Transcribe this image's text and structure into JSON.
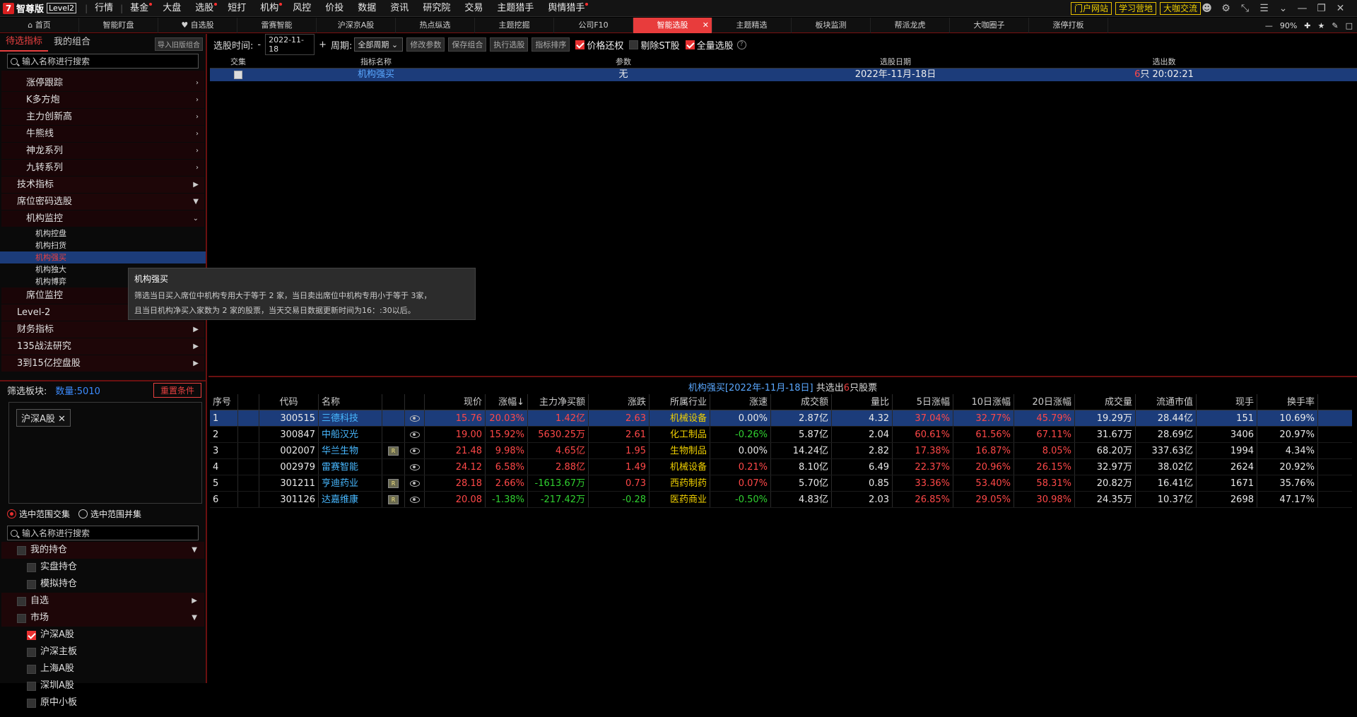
{
  "app": {
    "logo_text": "智尊版",
    "logo_badge": "Level2"
  },
  "main_menu": [
    {
      "label": "行情",
      "dot": false
    },
    {
      "label": "基金",
      "dot": true
    },
    {
      "label": "大盘",
      "dot": false
    },
    {
      "label": "选股",
      "dot": true
    },
    {
      "label": "短打",
      "dot": false
    },
    {
      "label": "机构",
      "dot": true
    },
    {
      "label": "风控",
      "dot": false
    },
    {
      "label": "价投",
      "dot": false
    },
    {
      "label": "数据",
      "dot": false
    },
    {
      "label": "资讯",
      "dot": false
    },
    {
      "label": "研究院",
      "dot": false
    },
    {
      "label": "交易",
      "dot": false
    },
    {
      "label": "主题猎手",
      "dot": false
    },
    {
      "label": "舆情猎手",
      "dot": true
    }
  ],
  "top_links": [
    "门户网站",
    "学习营地",
    "大咖交流"
  ],
  "tabs": [
    {
      "label": "首页",
      "active": false
    },
    {
      "label": "智能盯盘",
      "active": false
    },
    {
      "label": "自选股",
      "active": false
    },
    {
      "label": "雷赛智能",
      "active": false
    },
    {
      "label": "沪深京A股",
      "active": false
    },
    {
      "label": "热点纵选",
      "active": false
    },
    {
      "label": "主题挖掘",
      "active": false
    },
    {
      "label": "公司F10",
      "active": false
    },
    {
      "label": "智能选股",
      "active": true
    },
    {
      "label": "主题精选",
      "active": false
    },
    {
      "label": "板块监测",
      "active": false
    },
    {
      "label": "帮派龙虎",
      "active": false
    },
    {
      "label": "大咖圈子",
      "active": false
    },
    {
      "label": "涨停打板",
      "active": false
    }
  ],
  "zoom": "90%",
  "left": {
    "tab_active": "待选指标",
    "tab_other": "我的组合",
    "import_btn": "导入旧版组合",
    "search_placeholder": "输入名称进行搜索",
    "tree_l1": [
      "涨停跟踪",
      "K多方炮",
      "主力创新高",
      "牛熊线",
      "神龙系列",
      "九转系列"
    ],
    "tree_top": [
      "技术指标",
      "席位密码选股"
    ],
    "inst_group": "机构监控",
    "inst_items": [
      "机构控盘",
      "机构扫货",
      "机构强买",
      "机构独大",
      "机构博弈"
    ],
    "seat_group": "席位监控",
    "tree_bottom": [
      "Level-2",
      "财务指标",
      "135战法研究",
      "3到15亿控盘股"
    ],
    "filter_label": "筛选板块:",
    "filter_count": "数量:5010",
    "reset_btn": "重置条件",
    "chip": "沪深A股",
    "radio1": "选中范围交集",
    "radio2": "选中范围并集",
    "search2_placeholder": "输入名称进行搜索",
    "m_hold": "我的持仓",
    "m_real": "实盘持仓",
    "m_sim": "模拟持仓",
    "m_self": "自选",
    "m_market": "市场",
    "markets": [
      "沪深A股",
      "沪深主板",
      "上海A股",
      "深圳A股",
      "原中小板"
    ]
  },
  "tooltip": {
    "title": "机构强买",
    "line1": "筛选当日买入席位中机构专用大于等于 2 家，当日卖出席位中机构专用小于等于 3家，",
    "line2": "且当日机构净买入家数为 2 家的股票，当天交易日数据更新时间为16：:30以后。"
  },
  "selbar": {
    "time_label": "选股时间:",
    "minus": "-",
    "date": "2022-11-18",
    "plus": "+",
    "period_label": "周期:",
    "period": "全部周期",
    "btns": [
      "修改参数",
      "保存组合",
      "执行选股",
      "指标排序"
    ],
    "chk1": "价格还权",
    "chk2": "剔除ST股",
    "chk3": "全量选股"
  },
  "criteria": {
    "headers": [
      "交集",
      "指标名称",
      "参数",
      "选股日期",
      "选出数"
    ],
    "row": {
      "name": "机构强买",
      "param": "无",
      "date": "2022年-11月-18日",
      "count": "6",
      "count_suffix": "只 20:02:21"
    }
  },
  "result": {
    "title": "机构强买[2022年-11月-18日]",
    "mid": "共选出",
    "count": "6",
    "suffix": "只股票"
  },
  "grid": {
    "headers": [
      "序号",
      "代码",
      "名称",
      "现价",
      "涨幅↓",
      "主力净买额",
      "涨跌",
      "所属行业",
      "涨速",
      "成交额",
      "量比",
      "5日涨幅",
      "10日涨幅",
      "20日涨幅",
      "成交量",
      "流通市值",
      "现手",
      "换手率"
    ],
    "rows": [
      {
        "seq": "1",
        "code": "300515",
        "name": "三德科技",
        "r": false,
        "price": "15.76",
        "pct": "20.03%",
        "net": "1.42亿",
        "chg": "2.63",
        "ind": "机械设备",
        "speed": "0.00%",
        "amt": "2.87亿",
        "vr": "4.32",
        "d5": "37.04%",
        "d10": "32.77%",
        "d20": "45.79%",
        "vol": "19.29万",
        "mcap": "28.44亿",
        "hand": "151",
        "turn": "10.69%",
        "sel": true
      },
      {
        "seq": "2",
        "code": "300847",
        "name": "中船汉光",
        "r": false,
        "price": "19.00",
        "pct": "15.92%",
        "net": "5630.25万",
        "chg": "2.61",
        "ind": "化工制品",
        "speed": "-0.26%",
        "amt": "5.87亿",
        "vr": "2.04",
        "d5": "60.61%",
        "d10": "61.56%",
        "d20": "67.11%",
        "vol": "31.67万",
        "mcap": "28.69亿",
        "hand": "3406",
        "turn": "20.97%",
        "sel": false
      },
      {
        "seq": "3",
        "code": "002007",
        "name": "华兰生物",
        "r": true,
        "price": "21.48",
        "pct": "9.98%",
        "net": "4.65亿",
        "chg": "1.95",
        "ind": "生物制品",
        "speed": "0.00%",
        "amt": "14.24亿",
        "vr": "2.82",
        "d5": "17.38%",
        "d10": "16.87%",
        "d20": "8.05%",
        "vol": "68.20万",
        "mcap": "337.63亿",
        "hand": "1994",
        "turn": "4.34%",
        "sel": false
      },
      {
        "seq": "4",
        "code": "002979",
        "name": "雷赛智能",
        "r": false,
        "price": "24.12",
        "pct": "6.58%",
        "net": "2.88亿",
        "chg": "1.49",
        "ind": "机械设备",
        "speed": "0.21%",
        "amt": "8.10亿",
        "vr": "6.49",
        "d5": "22.37%",
        "d10": "20.96%",
        "d20": "26.15%",
        "vol": "32.97万",
        "mcap": "38.02亿",
        "hand": "2624",
        "turn": "20.92%",
        "sel": false
      },
      {
        "seq": "5",
        "code": "301211",
        "name": "亨迪药业",
        "r": true,
        "price": "28.18",
        "pct": "2.66%",
        "net": "-1613.67万",
        "chg": "0.73",
        "ind": "西药制药",
        "speed": "0.07%",
        "amt": "5.70亿",
        "vr": "0.85",
        "d5": "33.36%",
        "d10": "53.40%",
        "d20": "58.31%",
        "vol": "20.82万",
        "mcap": "16.41亿",
        "hand": "1671",
        "turn": "35.76%",
        "sel": false
      },
      {
        "seq": "6",
        "code": "301126",
        "name": "达嘉维康",
        "r": true,
        "price": "20.08",
        "pct": "-1.38%",
        "net": "-217.42万",
        "chg": "-0.28",
        "ind": "医药商业",
        "speed": "-0.50%",
        "amt": "4.83亿",
        "vr": "2.03",
        "d5": "26.85%",
        "d10": "29.05%",
        "d20": "30.98%",
        "vol": "24.35万",
        "mcap": "10.37亿",
        "hand": "2698",
        "turn": "47.17%",
        "sel": false
      }
    ]
  }
}
